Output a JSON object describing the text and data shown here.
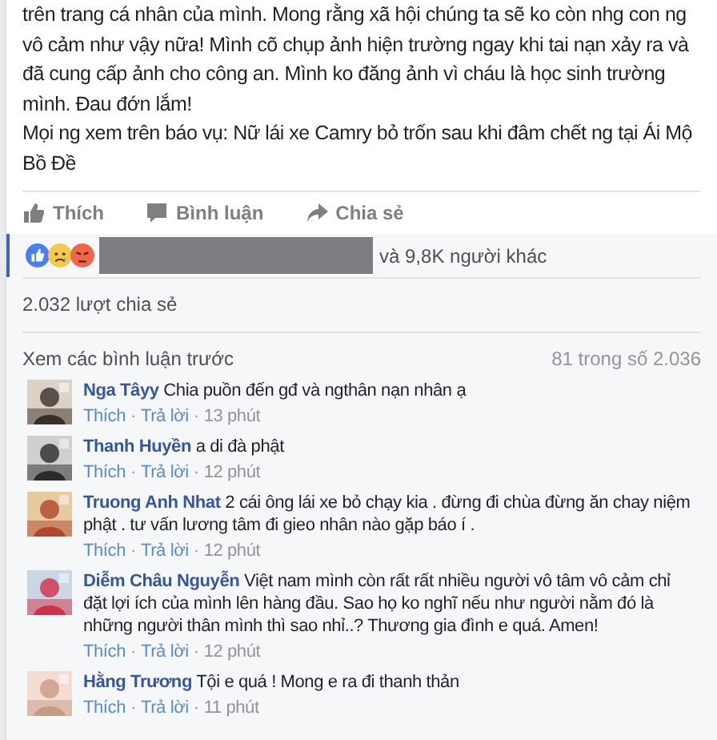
{
  "post": {
    "paragraphs": [
      "trên trang cá nhân của mình. Mong rằng xã hội chúng ta sẽ ko còn nhg con ng vô cảm như vậy nữa! Mình cõ chụp ảnh hiện trường ngay khi tai nạn xảy ra và đã cung cấp ảnh cho công an. Mình ko đăng ảnh vì cháu là học sinh trường mình. Đau đớn lắm!",
      "Mọi ng xem trên báo vụ: Nữ lái xe Camry bỏ trốn sau khi đâm chết ng tại Ái Mộ Bồ Đề"
    ]
  },
  "actions": [
    {
      "kind": "like",
      "label": "Thích"
    },
    {
      "kind": "comment",
      "label": "Bình luận"
    },
    {
      "kind": "share",
      "label": "Chia sẻ"
    }
  ],
  "reactions": {
    "icons": [
      {
        "kind": "like"
      },
      {
        "kind": "sad"
      },
      {
        "kind": "angry"
      }
    ],
    "others": "và 9,8K người khác"
  },
  "shares": "2.032 lượt chia sẻ",
  "comments_header": {
    "more": "Xem các bình luận trước",
    "count": "81 trong số 2.036"
  },
  "comments": [
    {
      "name": "Nga Tâyy",
      "text": "Chia puồn đến gđ và ngthân nạn nhân ạ",
      "meta": [
        {
          "kind": "link",
          "text": "Thích"
        },
        {
          "kind": "dot",
          "text": "·"
        },
        {
          "kind": "link",
          "text": "Trả lời"
        },
        {
          "kind": "dot",
          "text": "·"
        },
        {
          "kind": "time",
          "text": "13 phút"
        }
      ]
    },
    {
      "name": "Thanh Huyền",
      "text": "a di đà phật",
      "meta": [
        {
          "kind": "link",
          "text": "Thích"
        },
        {
          "kind": "dot",
          "text": "·"
        },
        {
          "kind": "link",
          "text": "Trả lời"
        },
        {
          "kind": "dot",
          "text": "·"
        },
        {
          "kind": "time",
          "text": "12 phút"
        }
      ]
    },
    {
      "name": "Truong Anh Nhat",
      "text": "2 cái ông lái xe bỏ chạy kia . đừng đi chùa đừng ăn chay niệm phật . tư vấn lương tâm đi gieo nhân nào gặp báo í .",
      "meta": [
        {
          "kind": "link",
          "text": "Thích"
        },
        {
          "kind": "dot",
          "text": "·"
        },
        {
          "kind": "link",
          "text": "Trả lời"
        },
        {
          "kind": "dot",
          "text": "·"
        },
        {
          "kind": "time",
          "text": "12 phút"
        }
      ]
    },
    {
      "name": "Diễm Châu Nguyễn",
      "text": "Việt nam mình còn rất rất nhiều người vô tâm vô cảm chỉ đặt lợi ích của mình lên hàng đầu. Sao họ ko nghĩ nếu như người nằm đó là những người thân mình thì sao nhỉ..? Thương gia đình e quá. Amen!",
      "meta": [
        {
          "kind": "link",
          "text": "Thích"
        },
        {
          "kind": "dot",
          "text": "·"
        },
        {
          "kind": "link",
          "text": "Trả lời"
        },
        {
          "kind": "dot",
          "text": "·"
        },
        {
          "kind": "time",
          "text": "12 phút"
        }
      ]
    },
    {
      "name": "Hằng Trương",
      "text": "Tội e quá ! Mong e ra đi thanh thản",
      "meta": [
        {
          "kind": "link",
          "text": "Thích"
        },
        {
          "kind": "dot",
          "text": "·"
        },
        {
          "kind": "link",
          "text": "Trả lời"
        },
        {
          "kind": "dot",
          "text": "·"
        },
        {
          "kind": "time",
          "text": "11 phút"
        }
      ]
    }
  ]
}
